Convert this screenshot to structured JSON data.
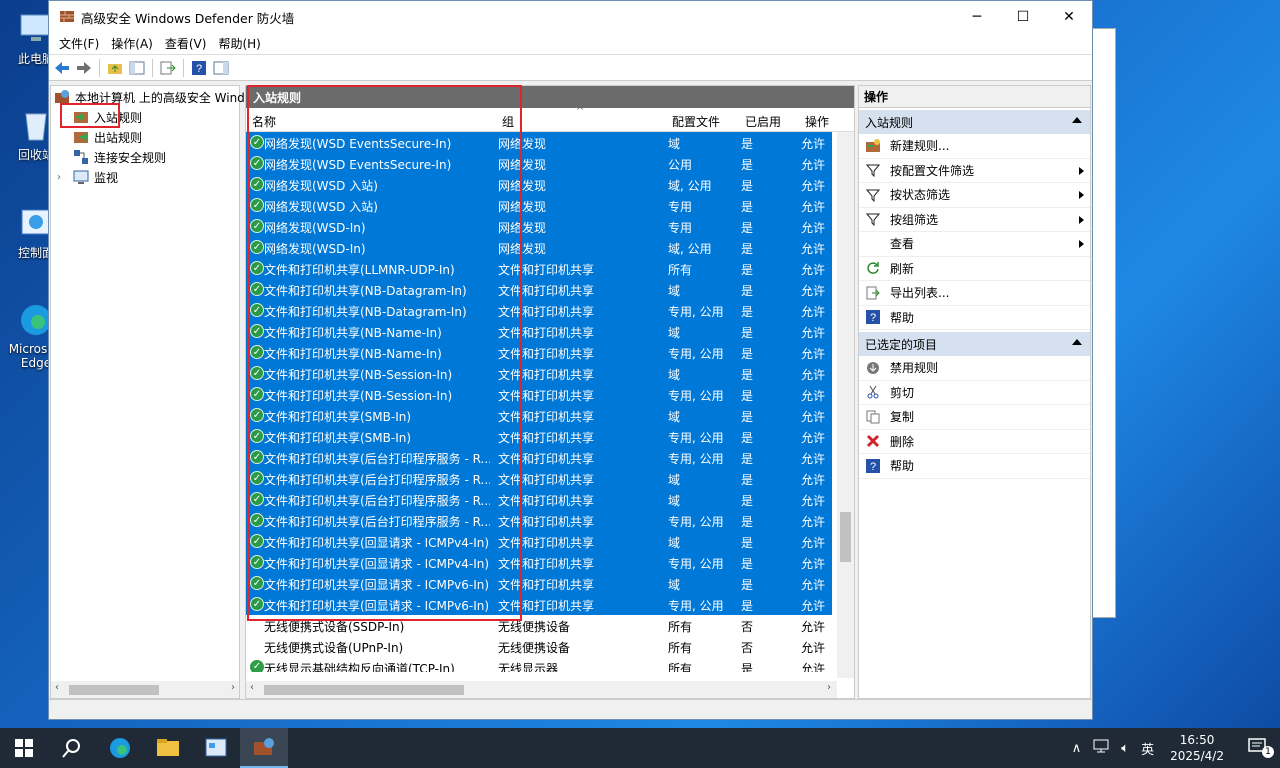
{
  "desktop": {
    "icons": [
      {
        "label": "此电脑"
      },
      {
        "label": "回收站"
      },
      {
        "label": "控制面"
      },
      {
        "label": "Microsoft Edge"
      }
    ]
  },
  "window": {
    "title": "高级安全 Windows Defender 防火墙",
    "minimize": "─",
    "maximize": "☐",
    "close": "✕"
  },
  "menu": {
    "file": "文件(F)",
    "action": "操作(A)",
    "view": "查看(V)",
    "help": "帮助(H)"
  },
  "tree": {
    "root": "本地计算机 上的高级安全 Windows Defender 防火墙",
    "inbound": "入站规则",
    "outbound": "出站规则",
    "consec": "连接安全规则",
    "monitor": "监视"
  },
  "center": {
    "title": "入站规则",
    "columns": {
      "name": "名称",
      "group": "组",
      "profile": "配置文件",
      "enabled": "已启用",
      "action": "操作"
    },
    "rows": [
      {
        "name": "网络发现(WSD EventsSecure-In)",
        "group": "网络发现",
        "profile": "域",
        "enabled": "是",
        "action": "允许"
      },
      {
        "name": "网络发现(WSD EventsSecure-In)",
        "group": "网络发现",
        "profile": "公用",
        "enabled": "是",
        "action": "允许"
      },
      {
        "name": "网络发现(WSD 入站)",
        "group": "网络发现",
        "profile": "域, 公用",
        "enabled": "是",
        "action": "允许"
      },
      {
        "name": "网络发现(WSD 入站)",
        "group": "网络发现",
        "profile": "专用",
        "enabled": "是",
        "action": "允许"
      },
      {
        "name": "网络发现(WSD-In)",
        "group": "网络发现",
        "profile": "专用",
        "enabled": "是",
        "action": "允许"
      },
      {
        "name": "网络发现(WSD-In)",
        "group": "网络发现",
        "profile": "域, 公用",
        "enabled": "是",
        "action": "允许"
      },
      {
        "name": "文件和打印机共享(LLMNR-UDP-In)",
        "group": "文件和打印机共享",
        "profile": "所有",
        "enabled": "是",
        "action": "允许"
      },
      {
        "name": "文件和打印机共享(NB-Datagram-In)",
        "group": "文件和打印机共享",
        "profile": "域",
        "enabled": "是",
        "action": "允许"
      },
      {
        "name": "文件和打印机共享(NB-Datagram-In)",
        "group": "文件和打印机共享",
        "profile": "专用, 公用",
        "enabled": "是",
        "action": "允许"
      },
      {
        "name": "文件和打印机共享(NB-Name-In)",
        "group": "文件和打印机共享",
        "profile": "域",
        "enabled": "是",
        "action": "允许"
      },
      {
        "name": "文件和打印机共享(NB-Name-In)",
        "group": "文件和打印机共享",
        "profile": "专用, 公用",
        "enabled": "是",
        "action": "允许"
      },
      {
        "name": "文件和打印机共享(NB-Session-In)",
        "group": "文件和打印机共享",
        "profile": "域",
        "enabled": "是",
        "action": "允许"
      },
      {
        "name": "文件和打印机共享(NB-Session-In)",
        "group": "文件和打印机共享",
        "profile": "专用, 公用",
        "enabled": "是",
        "action": "允许"
      },
      {
        "name": "文件和打印机共享(SMB-In)",
        "group": "文件和打印机共享",
        "profile": "域",
        "enabled": "是",
        "action": "允许"
      },
      {
        "name": "文件和打印机共享(SMB-In)",
        "group": "文件和打印机共享",
        "profile": "专用, 公用",
        "enabled": "是",
        "action": "允许"
      },
      {
        "name": "文件和打印机共享(后台打印程序服务 - R...",
        "group": "文件和打印机共享",
        "profile": "专用, 公用",
        "enabled": "是",
        "action": "允许"
      },
      {
        "name": "文件和打印机共享(后台打印程序服务 - R...",
        "group": "文件和打印机共享",
        "profile": "域",
        "enabled": "是",
        "action": "允许"
      },
      {
        "name": "文件和打印机共享(后台打印程序服务 - R...",
        "group": "文件和打印机共享",
        "profile": "域",
        "enabled": "是",
        "action": "允许"
      },
      {
        "name": "文件和打印机共享(后台打印程序服务 - R...",
        "group": "文件和打印机共享",
        "profile": "专用, 公用",
        "enabled": "是",
        "action": "允许"
      },
      {
        "name": "文件和打印机共享(回显请求 - ICMPv4-In)",
        "group": "文件和打印机共享",
        "profile": "域",
        "enabled": "是",
        "action": "允许"
      },
      {
        "name": "文件和打印机共享(回显请求 - ICMPv4-In)",
        "group": "文件和打印机共享",
        "profile": "专用, 公用",
        "enabled": "是",
        "action": "允许"
      },
      {
        "name": "文件和打印机共享(回显请求 - ICMPv6-In)",
        "group": "文件和打印机共享",
        "profile": "域",
        "enabled": "是",
        "action": "允许"
      },
      {
        "name": "文件和打印机共享(回显请求 - ICMPv6-In)",
        "group": "文件和打印机共享",
        "profile": "专用, 公用",
        "enabled": "是",
        "action": "允许"
      },
      {
        "name": "无线便携式设备(SSDP-In)",
        "group": "无线便携设备",
        "profile": "所有",
        "enabled": "否",
        "action": "允许"
      },
      {
        "name": "无线便携式设备(UPnP-In)",
        "group": "无线便携设备",
        "profile": "所有",
        "enabled": "否",
        "action": "允许"
      },
      {
        "name": "无线显示基础结构反向通道(TCP-In)",
        "group": "无线显示器",
        "profile": "所有",
        "enabled": "是",
        "action": "允许"
      }
    ]
  },
  "actions": {
    "header": "操作",
    "section1": "入站规则",
    "items1": [
      {
        "label": "新建规则...",
        "icon": "new-rule-icon"
      },
      {
        "label": "按配置文件筛选",
        "icon": "filter-icon"
      },
      {
        "label": "按状态筛选",
        "icon": "filter-icon"
      },
      {
        "label": "按组筛选",
        "icon": "filter-icon"
      },
      {
        "label": "查看",
        "icon": ""
      },
      {
        "label": "刷新",
        "icon": "refresh-icon"
      },
      {
        "label": "导出列表...",
        "icon": "export-icon"
      },
      {
        "label": "帮助",
        "icon": "help-icon"
      }
    ],
    "section2": "已选定的项目",
    "items2": [
      {
        "label": "禁用规则",
        "icon": "disable-icon"
      },
      {
        "label": "剪切",
        "icon": "cut-icon"
      },
      {
        "label": "复制",
        "icon": "copy-icon"
      },
      {
        "label": "删除",
        "icon": "delete-icon"
      },
      {
        "label": "帮助",
        "icon": "help-icon"
      }
    ]
  },
  "taskbar": {
    "ime": "英",
    "time": "16:50",
    "date": "2025/4/2",
    "notif_count": "1"
  }
}
